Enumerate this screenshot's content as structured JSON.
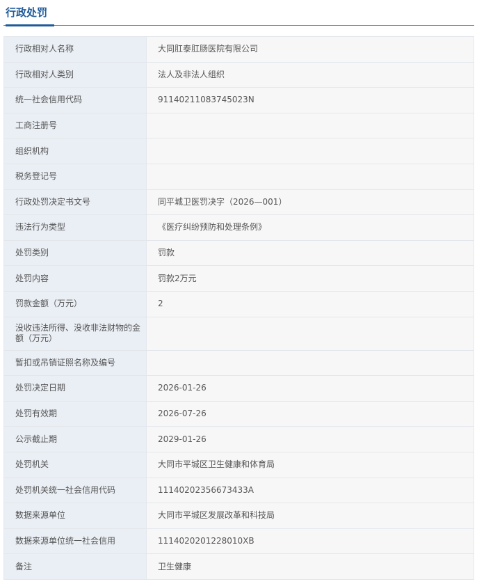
{
  "section_title": "行政处罚",
  "rows": [
    {
      "label": "行政相对人名称",
      "value": "大同肛泰肛肠医院有限公司"
    },
    {
      "label": "行政相对人类别",
      "value": "法人及非法人组织"
    },
    {
      "label": "统一社会信用代码",
      "value": "91140211083745023N"
    },
    {
      "label": "工商注册号",
      "value": ""
    },
    {
      "label": "组织机构",
      "value": ""
    },
    {
      "label": "税务登记号",
      "value": ""
    },
    {
      "label": "行政处罚决定书文号",
      "value": "同平城卫医罚决字（2026—001）"
    },
    {
      "label": "违法行为类型",
      "value": "《医疗纠纷预防和处理条例》"
    },
    {
      "label": "处罚类别",
      "value": "罚款"
    },
    {
      "label": "处罚内容",
      "value": "罚款2万元"
    },
    {
      "label": "罚款金额（万元）",
      "value": "2"
    },
    {
      "label": "没收违法所得、没收非法财物的金额（万元）",
      "value": ""
    },
    {
      "label": "暂扣或吊销证照名称及编号",
      "value": ""
    },
    {
      "label": "处罚决定日期",
      "value": "2026-01-26"
    },
    {
      "label": "处罚有效期",
      "value": "2026-07-26"
    },
    {
      "label": "公示截止期",
      "value": "2029-01-26"
    },
    {
      "label": "处罚机关",
      "value": "大同市平城区卫生健康和体育局"
    },
    {
      "label": "处罚机关统一社会信用代码",
      "value": "11140202356673433A"
    },
    {
      "label": "数据来源单位",
      "value": "大同市平城区发展改革和科技局"
    },
    {
      "label": "数据来源单位统一社会信用",
      "value": "1114020201228010XB"
    },
    {
      "label": "备注",
      "value": "卫生健康"
    }
  ]
}
